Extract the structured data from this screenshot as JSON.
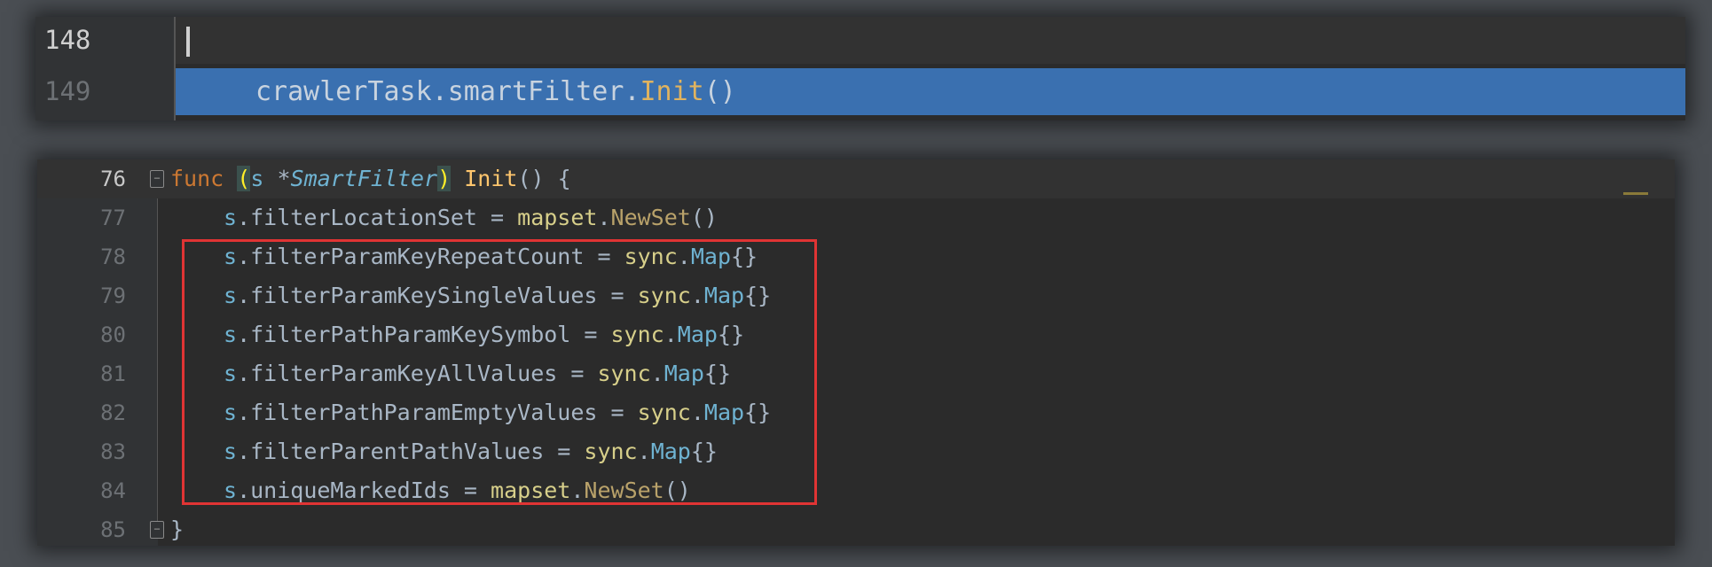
{
  "top_editor": {
    "lines": [
      {
        "number": "148",
        "text": ""
      },
      {
        "number": "149",
        "receiver": "crawlerTask",
        "sep1": ".",
        "field": "smartFilter",
        "sep2": ".",
        "method": "Init",
        "suffix": "()"
      }
    ]
  },
  "bottom_editor": {
    "header": {
      "number": "76",
      "keyword": "func",
      "open_paren": "(",
      "receiver": "s",
      "star": " *",
      "type_name": "SmartFilter",
      "close_paren": ")",
      "func_name": "Init",
      "tail": "() {"
    },
    "body": [
      {
        "number": "77",
        "recv": "s",
        "field": ".filterLocationSet = ",
        "pkg": "mapset",
        "dot": ".",
        "member": "NewSet",
        "tail": "()"
      },
      {
        "number": "78",
        "recv": "s",
        "field": ".filterParamKeyRepeatCount = ",
        "pkg": "sync",
        "dot": ".",
        "member": "Map",
        "tail": "{}"
      },
      {
        "number": "79",
        "recv": "s",
        "field": ".filterParamKeySingleValues = ",
        "pkg": "sync",
        "dot": ".",
        "member": "Map",
        "tail": "{}"
      },
      {
        "number": "80",
        "recv": "s",
        "field": ".filterPathParamKeySymbol = ",
        "pkg": "sync",
        "dot": ".",
        "member": "Map",
        "tail": "{}"
      },
      {
        "number": "81",
        "recv": "s",
        "field": ".filterParamKeyAllValues = ",
        "pkg": "sync",
        "dot": ".",
        "member": "Map",
        "tail": "{}"
      },
      {
        "number": "82",
        "recv": "s",
        "field": ".filterPathParamEmptyValues = ",
        "pkg": "sync",
        "dot": ".",
        "member": "Map",
        "tail": "{}"
      },
      {
        "number": "83",
        "recv": "s",
        "field": ".filterParentPathValues = ",
        "pkg": "sync",
        "dot": ".",
        "member": "Map",
        "tail": "{}"
      },
      {
        "number": "84",
        "recv": "s",
        "field": ".uniqueMarkedIds = ",
        "pkg": "mapset",
        "dot": ".",
        "member": "NewSet",
        "tail": "()"
      }
    ],
    "footer": {
      "number": "85",
      "text": "}"
    }
  },
  "colors": {
    "highlight_box": "#e03434",
    "selected_line": "#3a70b0",
    "editor_bg": "#2b2b2b"
  },
  "icons": {
    "fold_open": "fold-open-icon",
    "fold_close": "fold-close-icon"
  }
}
